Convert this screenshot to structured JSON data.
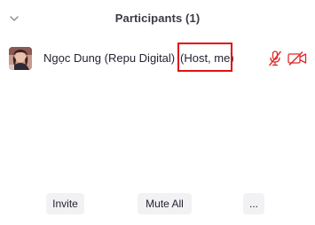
{
  "panel": {
    "title": "Participants (1)",
    "collapse_icon": "chevron-down-icon"
  },
  "participants": [
    {
      "name": "Ngọc Dung (Repu Digital)",
      "role": "(Host, me)",
      "mic_icon": "microphone-muted-icon",
      "video_icon": "video-off-icon",
      "status_color": "#e02828"
    }
  ],
  "footer": {
    "invite_label": "Invite",
    "mute_all_label": "Mute All",
    "more_label": "..."
  },
  "colors": {
    "highlight": "#e01010",
    "button_bg": "#f2f2f4",
    "text": "#232333"
  }
}
